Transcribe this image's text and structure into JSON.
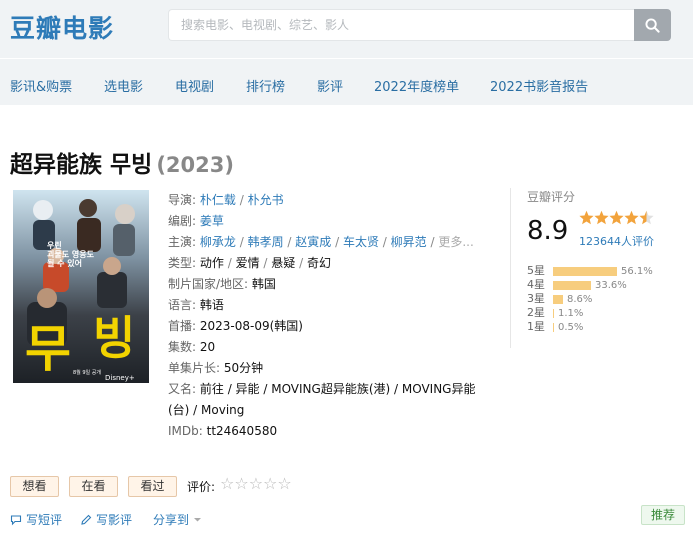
{
  "header": {
    "logo": "豆瓣电影",
    "search_placeholder": "搜索电影、电视剧、综艺、影人"
  },
  "nav": [
    "影讯&购票",
    "选电影",
    "电视剧",
    "排行榜",
    "影评",
    "2022年度榜单",
    "2022书影音报告"
  ],
  "title": {
    "name": "超异能族 무빙",
    "year": "(2023)"
  },
  "poster": {
    "big_text_1": "무",
    "big_text_2": "빙",
    "tagline": "우린\n괴물도 영웅도\n될 수 있어",
    "date_text": "8월 9일 공개",
    "platform": "Disney+"
  },
  "info": {
    "director_label": "导演",
    "directors": [
      "朴仁载",
      "朴允书"
    ],
    "writer_label": "编剧",
    "writers": [
      "姜草"
    ],
    "cast_label": "主演",
    "cast": [
      "柳承龙",
      "韩孝周",
      "赵寅成",
      "车太贤",
      "柳昇范"
    ],
    "cast_more": "更多...",
    "genre_label": "类型",
    "genres": [
      "动作",
      "爱情",
      "悬疑",
      "奇幻"
    ],
    "country_label": "制片国家/地区",
    "country": "韩国",
    "language_label": "语言",
    "language": "韩语",
    "premiere_label": "首播",
    "premiere": "2023-08-09(韩国)",
    "episodes_label": "集数",
    "episodes": "20",
    "runtime_label": "单集片长",
    "runtime": "50分钟",
    "aka_label": "又名",
    "aka_line1": "前往 / 异能 / MOVING超异能族(港) / MOVING异能",
    "aka_line2": "(台) / Moving",
    "imdb_label": "IMDb",
    "imdb": "tt24640580"
  },
  "rating": {
    "title": "豆瓣评分",
    "score": "8.9",
    "stars_value": 4.5,
    "votes": "123644人评价",
    "bars": [
      {
        "label": "5星",
        "percent": 56.1,
        "text": "56.1%"
      },
      {
        "label": "4星",
        "percent": 33.6,
        "text": "33.6%"
      },
      {
        "label": "3星",
        "percent": 8.6,
        "text": "8.6%"
      },
      {
        "label": "2星",
        "percent": 1.1,
        "text": "1.1%"
      },
      {
        "label": "1星",
        "percent": 0.5,
        "text": "0.5%"
      }
    ]
  },
  "actions": {
    "want": "想看",
    "watching": "在看",
    "watched": "看过",
    "eval_label": "评价:",
    "eval_stars": "☆☆☆☆☆",
    "short_review": "写短评",
    "review": "写影评",
    "share": "分享到",
    "recommend": "推荐"
  },
  "colors": {
    "link": "#2e7bb8",
    "star": "#f2a33c",
    "bar": "#f7cd7e",
    "header_bg": "#f0f3f5"
  }
}
